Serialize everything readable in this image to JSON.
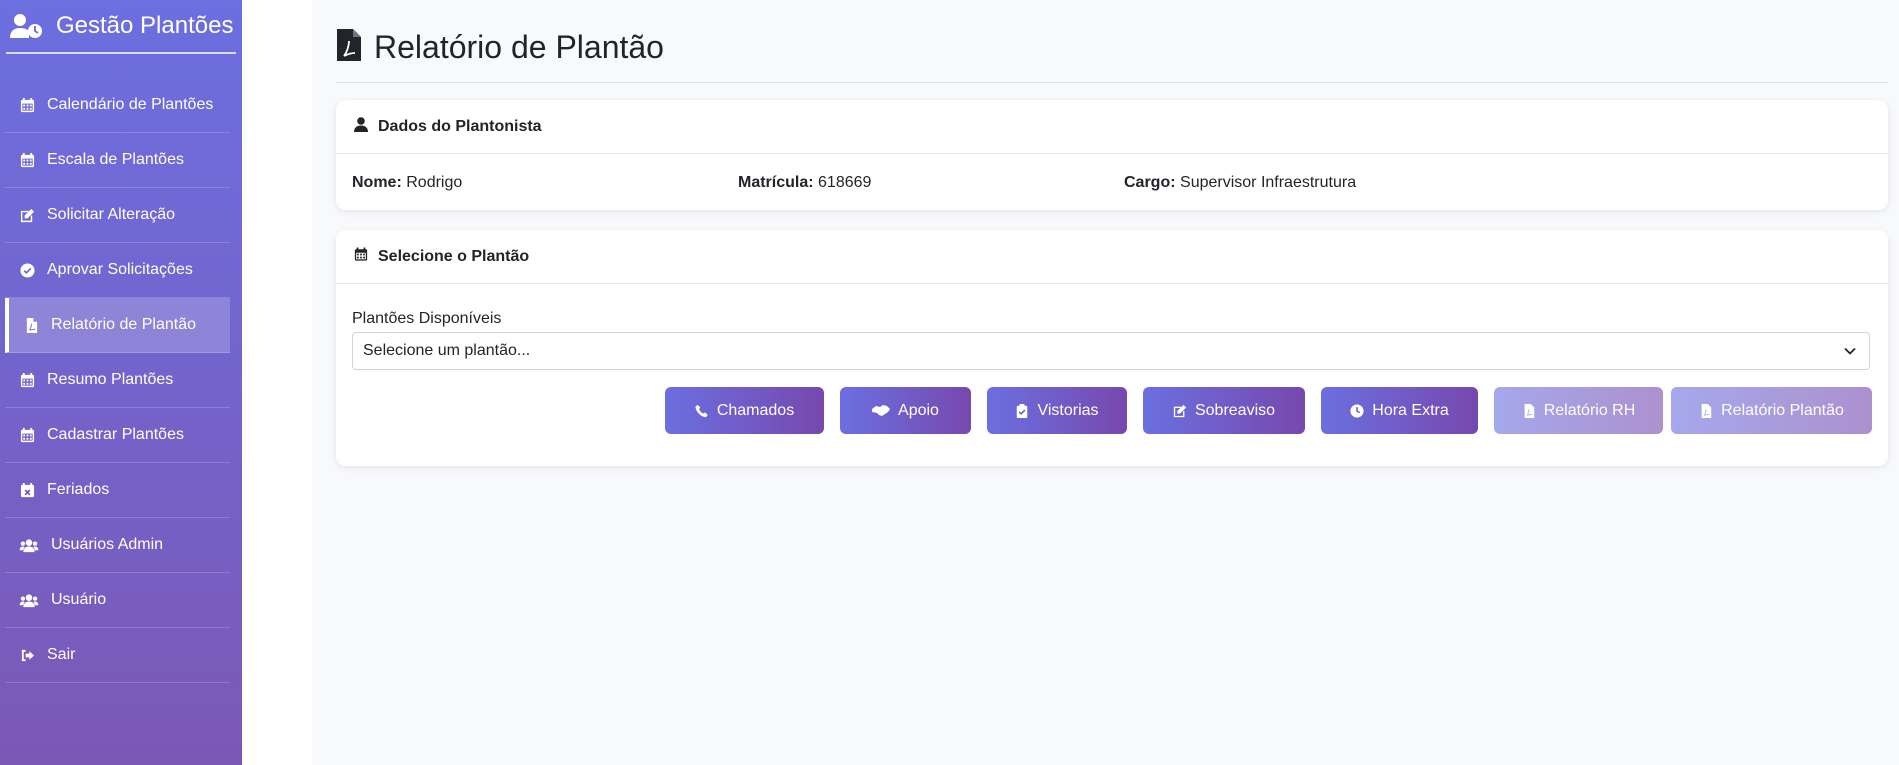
{
  "sidebar": {
    "brand": "Gestão Plantões",
    "items": [
      {
        "label": "Calendário de Plantões",
        "icon": "calendar-icon"
      },
      {
        "label": "Escala de Plantões",
        "icon": "calendar-icon"
      },
      {
        "label": "Solicitar Alteração",
        "icon": "edit-icon"
      },
      {
        "label": "Aprovar Solicitações",
        "icon": "check-circle-icon"
      },
      {
        "label": "Relatório de Plantão",
        "icon": "file-pdf-icon",
        "active": true
      },
      {
        "label": "Resumo Plantões",
        "icon": "calendar-icon"
      },
      {
        "label": "Cadastrar Plantões",
        "icon": "calendar-icon"
      },
      {
        "label": "Feriados",
        "icon": "calendar-x-icon"
      },
      {
        "label": "Usuários Admin",
        "icon": "users-icon"
      },
      {
        "label": "Usuário",
        "icon": "users-icon"
      },
      {
        "label": "Sair",
        "icon": "sign-out-icon"
      }
    ]
  },
  "page": {
    "title": "Relatório de Plantão"
  },
  "plantonista": {
    "header": "Dados do Plantonista",
    "nome_label": "Nome:",
    "nome": "Rodrigo",
    "matricula_label": "Matrícula:",
    "matricula": "618669",
    "cargo_label": "Cargo:",
    "cargo": "Supervisor Infraestrutura"
  },
  "plantao": {
    "header": "Selecione o Plantão",
    "select_label": "Plantões Disponíveis",
    "select_value": "Selecione um plantão...",
    "buttons": {
      "chamados": "Chamados",
      "apoio": "Apoio",
      "vistorias": "Vistorias",
      "sobreaviso": "Sobreaviso",
      "hora_extra": "Hora Extra",
      "relatorio_rh": "Relatório RH",
      "relatorio_plantao": "Relatório Plantão"
    }
  },
  "colors": {
    "sidebar_top": "#6c6fe0",
    "sidebar_bottom": "#7b58b6",
    "button_start": "#6b6fe0",
    "button_end": "#7748ae"
  }
}
